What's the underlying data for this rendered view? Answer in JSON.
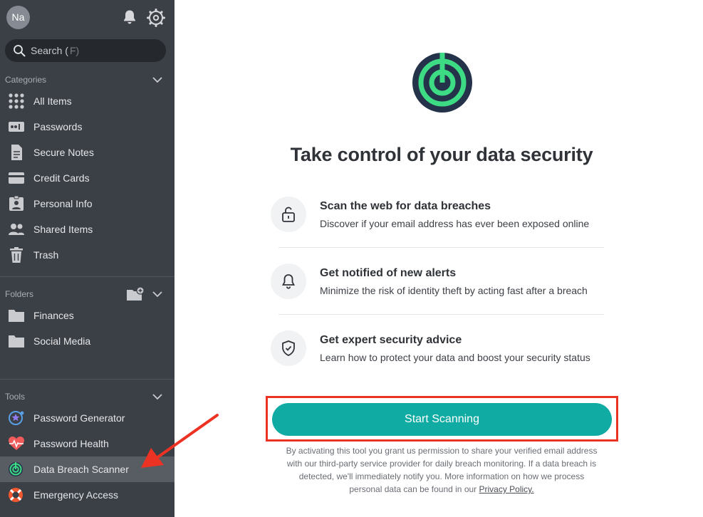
{
  "sidebar": {
    "avatar_initials": "Na",
    "search": {
      "label": "Search (",
      "shortcut": "F)"
    },
    "categories": {
      "header": "Categories",
      "items": [
        {
          "label": "All Items",
          "icon": "grid-icon"
        },
        {
          "label": "Passwords",
          "icon": "password-icon"
        },
        {
          "label": "Secure Notes",
          "icon": "note-icon"
        },
        {
          "label": "Credit Cards",
          "icon": "credit-card-icon"
        },
        {
          "label": "Personal Info",
          "icon": "id-card-icon"
        },
        {
          "label": "Shared Items",
          "icon": "people-icon"
        },
        {
          "label": "Trash",
          "icon": "trash-icon"
        }
      ]
    },
    "folders": {
      "header": "Folders",
      "items": [
        {
          "label": "Finances",
          "icon": "folder-icon"
        },
        {
          "label": "Social Media",
          "icon": "folder-icon"
        }
      ]
    },
    "tools": {
      "header": "Tools",
      "items": [
        {
          "label": "Password Generator",
          "icon": "generator-icon"
        },
        {
          "label": "Password Health",
          "icon": "heart-pulse-icon"
        },
        {
          "label": "Data Breach Scanner",
          "icon": "radar-icon",
          "active": true
        },
        {
          "label": "Emergency Access",
          "icon": "lifebuoy-icon"
        }
      ]
    }
  },
  "main": {
    "headline": "Take control of your data security",
    "features": [
      {
        "title": "Scan the web for data breaches",
        "desc": "Discover if your email address has ever been exposed online",
        "icon": "unlock-icon"
      },
      {
        "title": "Get notified of new alerts",
        "desc": "Minimize the risk of identity theft by acting fast after a breach",
        "icon": "bell-icon"
      },
      {
        "title": "Get expert security advice",
        "desc": "Learn how to protect your data and boost your security status",
        "icon": "shield-check-icon"
      }
    ],
    "cta_label": "Start Scanning",
    "legal_lines": [
      "By activating this tool you grant us permission to share your verified email address",
      "with our third-party service provider for daily breach monitoring. If a data breach is",
      "detected, we'll immediately notify you. More information on how we process",
      "personal data can be found in our "
    ],
    "legal_link": "Privacy Policy."
  },
  "colors": {
    "sidebar_bg": "#3b3f46",
    "accent_teal": "#10aba3",
    "logo_green": "#3ddc84",
    "logo_navy": "#24324a",
    "annotation_red": "#ec3323"
  }
}
